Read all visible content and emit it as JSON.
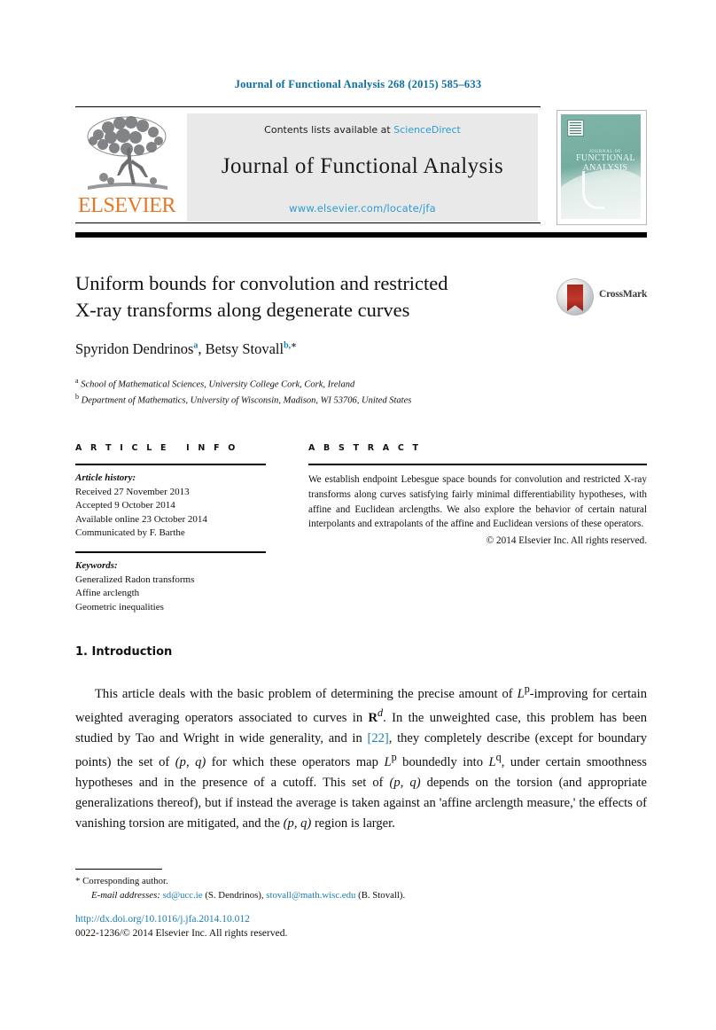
{
  "running_head": "Journal of Functional Analysis 268 (2015) 585–633",
  "masthead": {
    "publisher_name": "ELSEVIER",
    "contents_prefix": "Contents lists available at",
    "contents_link": "ScienceDirect",
    "journal_title": "Journal of Functional Analysis",
    "journal_url": "www.elsevier.com/locate/jfa",
    "cover": {
      "line1": "JOURNAL OF",
      "line2": "FUNCTIONAL",
      "line3": "ANALYSIS"
    }
  },
  "article": {
    "title_line1": "Uniform bounds for convolution and restricted",
    "title_line2": "X-ray transforms along degenerate curves",
    "crossmark_label": "CrossMark",
    "authors": {
      "author1": "Spyridon Dendrinos",
      "author1_mark": "a",
      "separator": ", ",
      "author2": "Betsy Stovall",
      "author2_mark": "b,",
      "author2_star": "∗"
    },
    "affiliations": [
      {
        "mark": "a",
        "text": "School of Mathematical Sciences, University College Cork, Cork, Ireland"
      },
      {
        "mark": "b",
        "text": "Department of Mathematics, University of Wisconsin, Madison, WI 53706, United States"
      }
    ]
  },
  "article_info": {
    "heading": "ARTICLE INFO",
    "history_label": "Article history:",
    "history": [
      "Received 27 November 2013",
      "Accepted 9 October 2014",
      "Available online 23 October 2014",
      "Communicated by F. Barthe"
    ],
    "keywords_label": "Keywords:",
    "keywords": [
      "Generalized Radon transforms",
      "Affine arclength",
      "Geometric inequalities"
    ]
  },
  "abstract": {
    "heading": "ABSTRACT",
    "text": "We establish endpoint Lebesgue space bounds for convolution and restricted X-ray transforms along curves satisfying fairly minimal differentiability hypotheses, with affine and Euclidean arclengths. We also explore the behavior of certain natural interpolants and extrapolants of the affine and Euclidean versions of these operators.",
    "copyright": "© 2014 Elsevier Inc. All rights reserved."
  },
  "body": {
    "section_title": "1. Introduction",
    "paragraph": {
      "part1": "This article deals with the basic problem of determining the precise amount of ",
      "math1": "L",
      "math1_sup": "p",
      "part2": "-improving for certain weighted averaging operators associated to curves in ",
      "math2": "R",
      "math2_sup": "d",
      "part3": ". In the unweighted case, this problem has been studied by Tao and Wright in wide generality, and in ",
      "ref": "[22]",
      "part4": ", they completely describe (except for boundary points) the set of ",
      "math3": "(p, q)",
      "part5": " for which these operators map ",
      "math4": "L",
      "math4_sup": "p",
      "part6": " boundedly into ",
      "math5": "L",
      "math5_sup": "q",
      "part7": ", under certain smoothness hypotheses and in the presence of a cutoff. This set of ",
      "math6": "(p, q)",
      "part8": " depends on the torsion (and appropriate generalizations thereof), but if instead the average is taken against an 'affine arclength measure,' the effects of vanishing torsion are mitigated, and the ",
      "math7": "(p, q)",
      "part9": " region is larger."
    }
  },
  "footer": {
    "corresponding_marker": "*",
    "corresponding_text": "Corresponding author.",
    "email_label": "E-mail addresses:",
    "email1": "sd@ucc.ie",
    "email1_owner": "(S. Dendrinos),",
    "email2": "stovall@math.wisc.edu",
    "email2_owner": "(B. Stovall).",
    "doi": "http://dx.doi.org/10.1016/j.jfa.2014.10.012",
    "issn": "0022-1236/© 2014 Elsevier Inc. All rights reserved."
  },
  "colors": {
    "link": "#1a7fb5",
    "sciencedirect": "#2e9bd6",
    "elsevier_orange": "#e87722",
    "cover_teal": "#74ada0"
  }
}
